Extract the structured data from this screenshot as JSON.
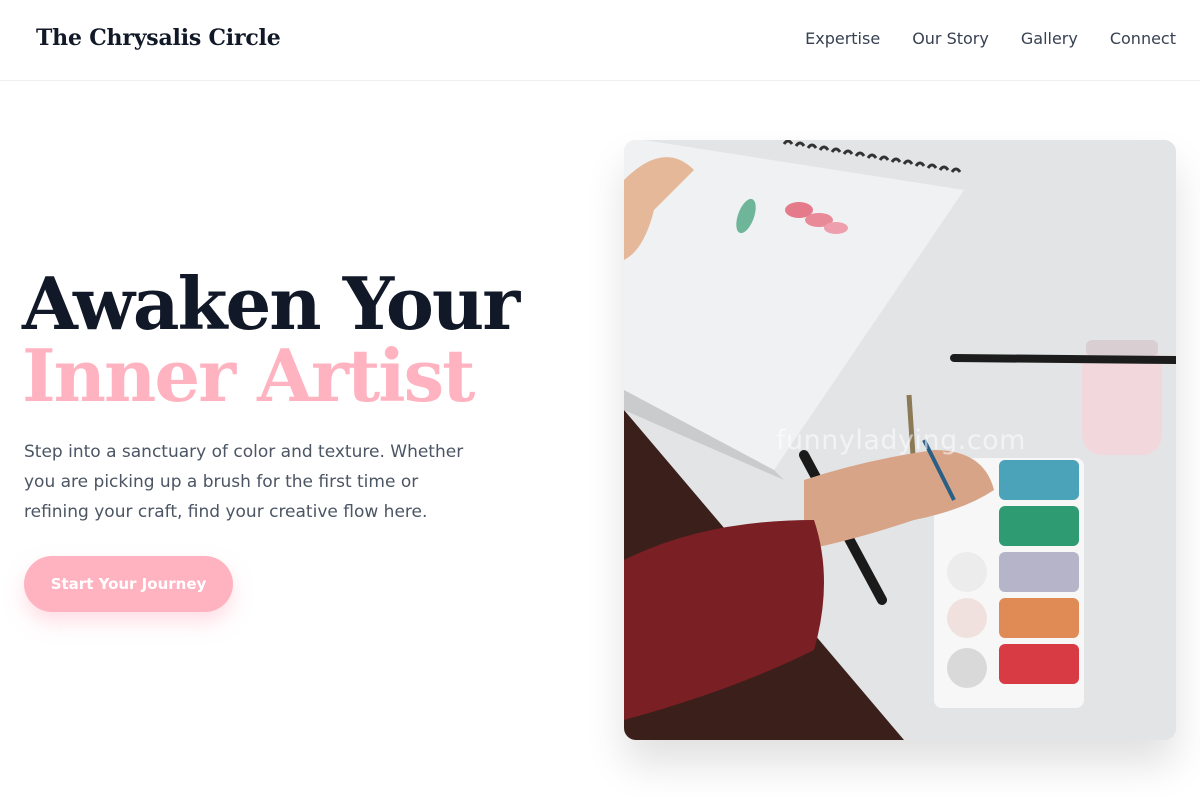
{
  "header": {
    "brand": "The Chrysalis Circle",
    "nav": [
      "Expertise",
      "Our Story",
      "Gallery",
      "Connect"
    ]
  },
  "hero": {
    "title_line1": "Awaken Your",
    "title_line2": "Inner Artist",
    "description": "Step into a sanctuary of color and texture. Whether you are picking up a brush for the first time or refining your craft, find your creative flow here.",
    "cta_label": "Start Your Journey"
  },
  "image": {
    "alt": "Person painting with watercolors on a sketchbook beside a paint palette",
    "watermark": "funnyladying.com"
  },
  "colors": {
    "accent_pink": "#ffb3c1",
    "heading_dark": "#111827",
    "body_text": "#4b5563"
  }
}
